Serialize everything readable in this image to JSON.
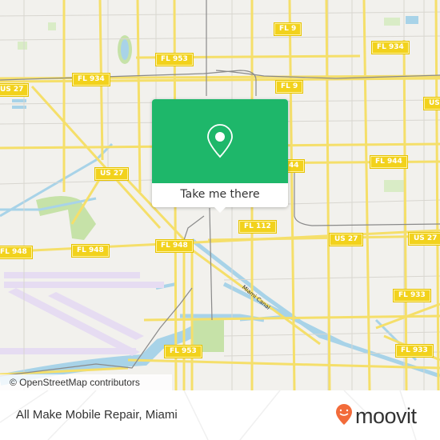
{
  "map": {
    "shields": [
      {
        "label": "FL 9",
        "id": "fl9-top"
      },
      {
        "label": "FL 953",
        "id": "fl953-top"
      },
      {
        "label": "FL 934",
        "id": "fl934-left"
      },
      {
        "label": "FL 934",
        "id": "fl934-right"
      },
      {
        "label": "US 27",
        "id": "us27-topleft"
      },
      {
        "label": "FL 9",
        "id": "fl9-mid"
      },
      {
        "label": "US",
        "id": "us-right-edge"
      },
      {
        "label": "US 27",
        "id": "us27-mid"
      },
      {
        "label": "FL 944",
        "id": "fl944"
      },
      {
        "label": "44",
        "id": "fl944-partial"
      },
      {
        "label": "FL 112",
        "id": "fl112"
      },
      {
        "label": "US 27",
        "id": "us27-lower"
      },
      {
        "label": "US 27",
        "id": "us27-right"
      },
      {
        "label": "FL 948",
        "id": "fl948-left"
      },
      {
        "label": "FL 948",
        "id": "fl948-mid"
      },
      {
        "label": "FL 948",
        "id": "fl948-right"
      },
      {
        "label": "FL 933",
        "id": "fl933-upper"
      },
      {
        "label": "FL 933",
        "id": "fl933-lower"
      },
      {
        "label": "FL 953",
        "id": "fl953-bottom"
      }
    ],
    "canal_label": "Miami Canal",
    "attribution": "© OpenStreetMap contributors"
  },
  "popup": {
    "button_label": "Take me there",
    "icon": "location-pin-icon",
    "color": "#1eb76a"
  },
  "footer": {
    "place_name": "All Make Mobile Repair, Miami",
    "logo_text": "moovit",
    "logo_color": "#f26b3a"
  }
}
